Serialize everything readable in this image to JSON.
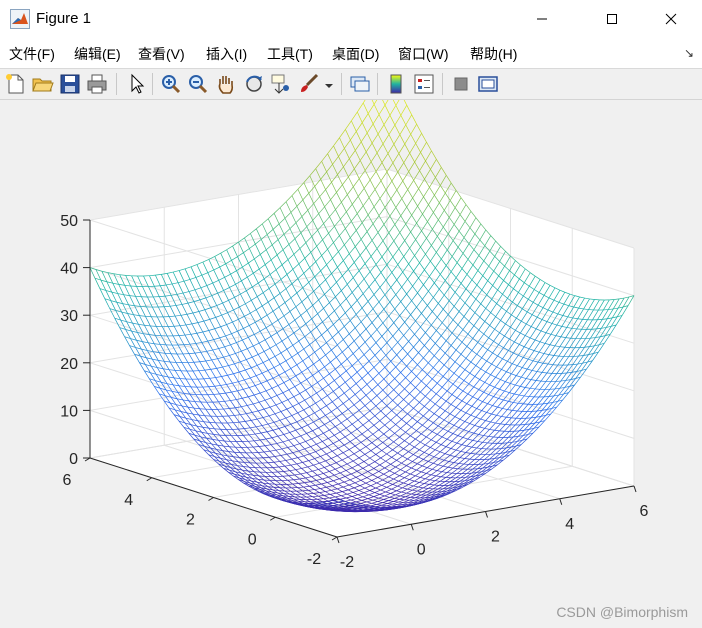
{
  "window": {
    "title": "Figure 1"
  },
  "menu": {
    "items": [
      "文件(F)",
      "编辑(E)",
      "查看(V)",
      "插入(I)",
      "工具(T)",
      "桌面(D)",
      "窗口(W)",
      "帮助(H)"
    ]
  },
  "toolbar": {
    "icons": [
      "new-figure",
      "open-file",
      "save",
      "print",
      "edit-plot-cursor",
      "zoom-in",
      "zoom-out",
      "pan-hand",
      "rotate-3d",
      "data-cursor",
      "brush",
      "brush-dropdown",
      "link-plot",
      "insert-colorbar",
      "insert-legend",
      "hide-plot-tools",
      "show-plot-tools"
    ]
  },
  "axes": {
    "z_ticks": [
      "0",
      "10",
      "20",
      "30",
      "40",
      "50"
    ],
    "x_ticks": [
      "-2",
      "0",
      "2",
      "4",
      "6"
    ],
    "y_ticks": [
      "-2",
      "0",
      "2",
      "4",
      "6"
    ]
  },
  "chart_data": {
    "type": "surface-mesh",
    "function": "z = x^2 + y^2",
    "x_range": [
      -2,
      6
    ],
    "y_range": [
      -2,
      6
    ],
    "zlim": [
      0,
      50
    ],
    "colormap": "parula",
    "grid": true,
    "view": "default 3-D"
  },
  "watermark": {
    "text": "CSDN @Bimorphism"
  }
}
